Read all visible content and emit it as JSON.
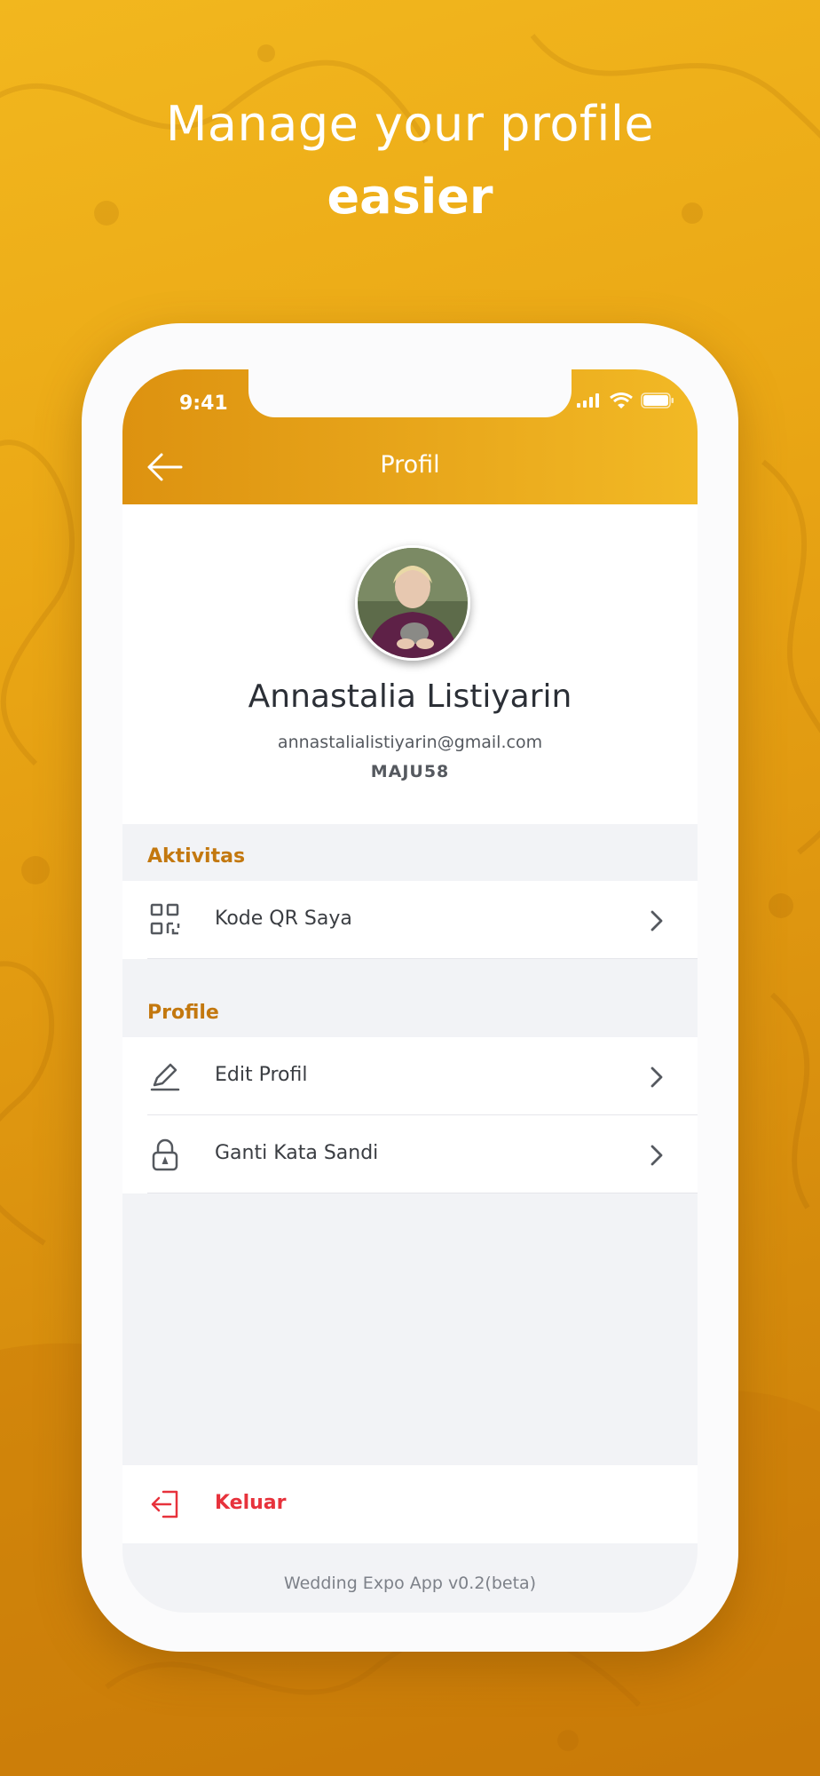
{
  "promo": {
    "headline_line1": "Manage your profile",
    "headline_line2": "easier"
  },
  "status_bar": {
    "time": "9:41"
  },
  "app_bar": {
    "title": "Profil"
  },
  "profile": {
    "name": "Annastalia Listiyarin",
    "email": "annastalialistiyarin@gmail.com",
    "code": "MAJU58"
  },
  "sections": [
    {
      "title": "Aktivitas",
      "items": [
        {
          "label": "Kode QR Saya",
          "icon": "qr-code-icon"
        }
      ]
    },
    {
      "title": "Profile",
      "items": [
        {
          "label": "Edit Profil",
          "icon": "pencil-icon"
        },
        {
          "label": "Ganti Kata Sandi",
          "icon": "lock-icon"
        }
      ]
    }
  ],
  "logout": {
    "label": "Keluar",
    "icon": "logout-icon"
  },
  "footer": {
    "version": "Wedding Expo App v0.2(beta)"
  },
  "colors": {
    "accent_gold": "#f2b925",
    "accent_dark_gold": "#dd9210",
    "section_title": "#c3780f",
    "logout_red": "#e7323c"
  }
}
